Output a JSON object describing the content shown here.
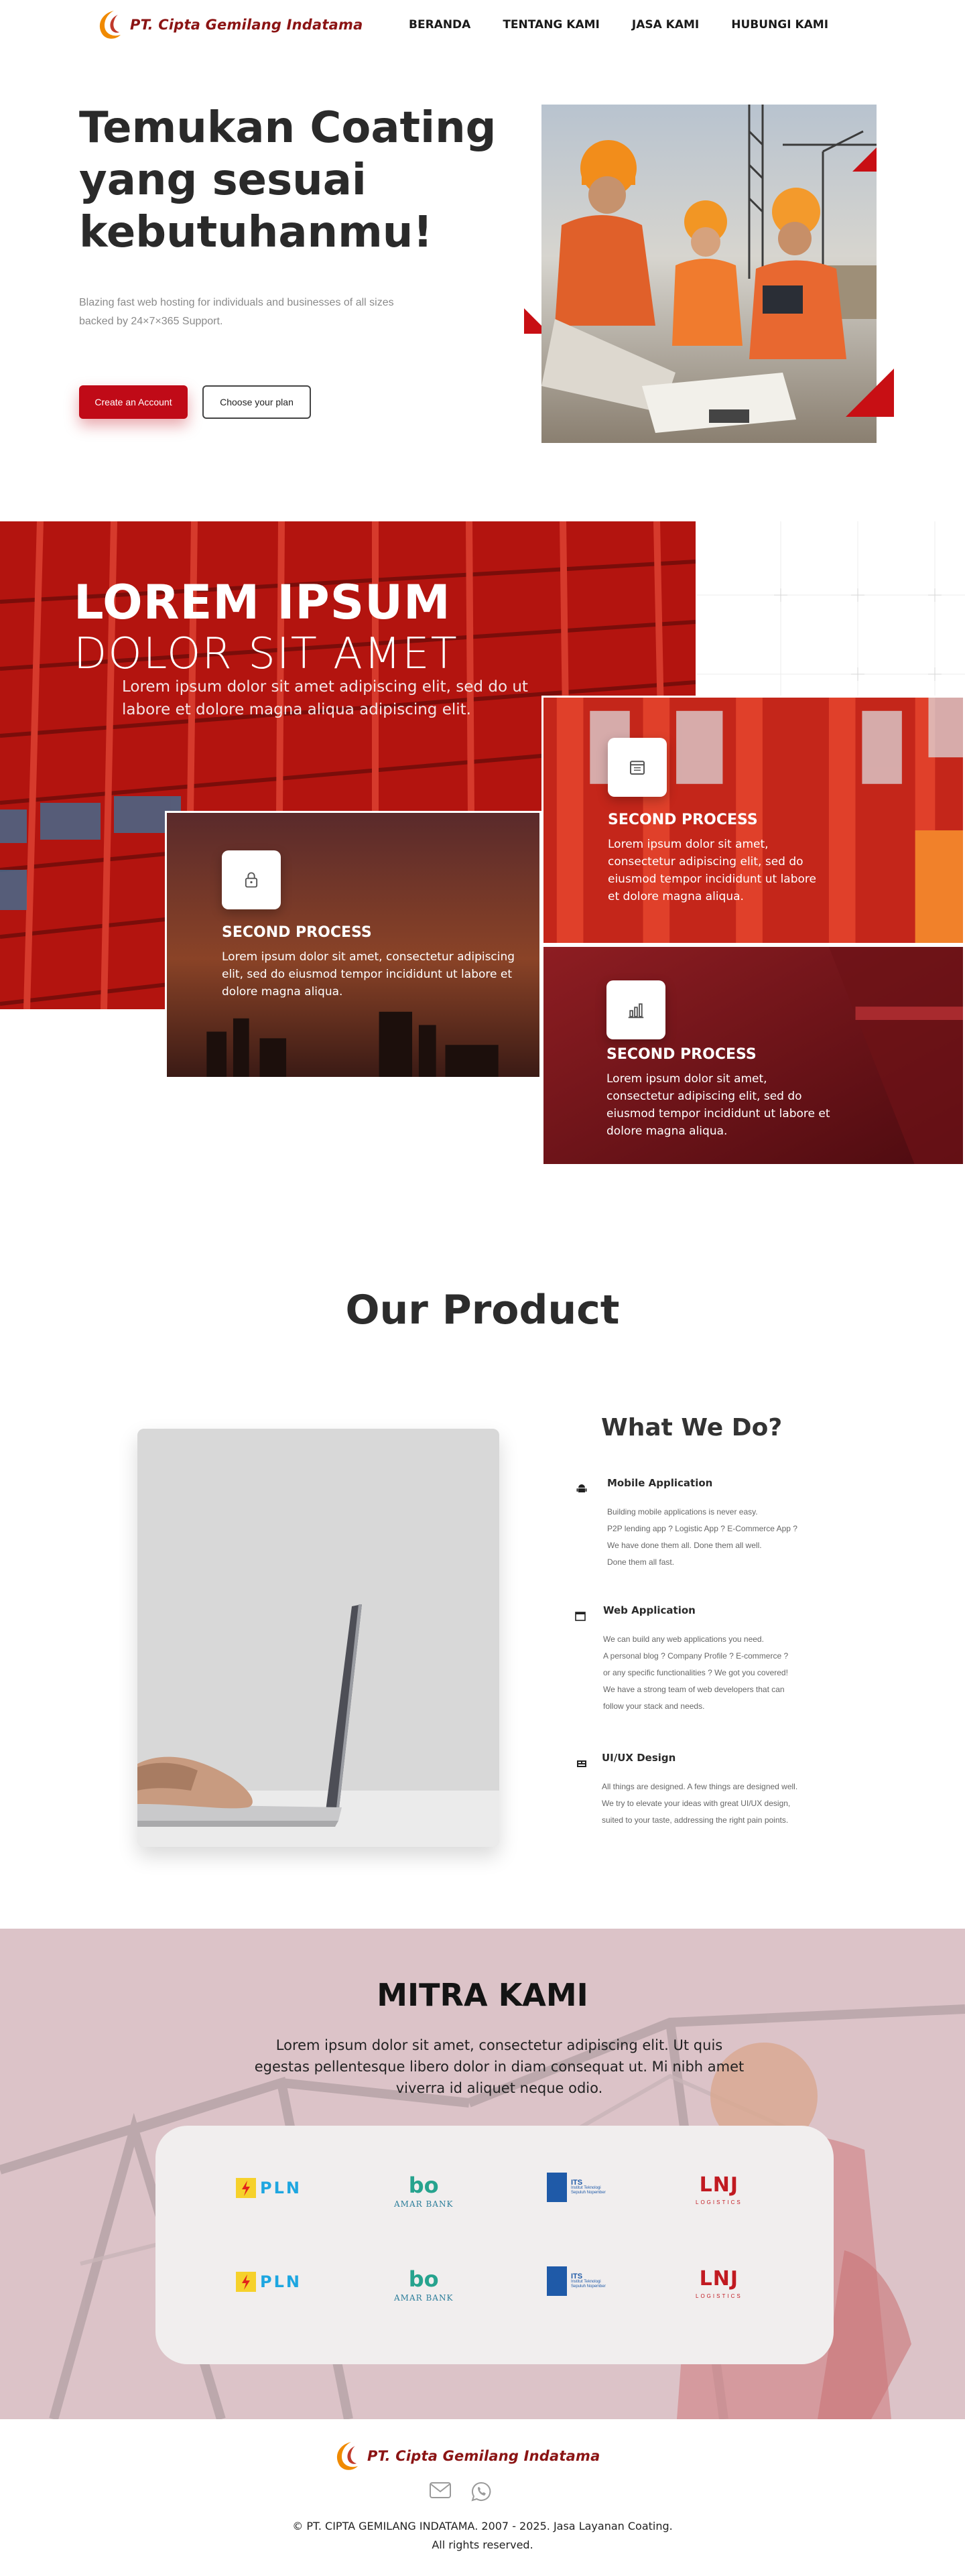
{
  "nav": {
    "logo_text": "PT. Cipta Gemilang Indatama",
    "links": [
      "BERANDA",
      "TENTANG KAMI",
      "JASA KAMI",
      "HUBUNGI KAMI"
    ]
  },
  "hero": {
    "title": "Temukan Coating yang sesuai kebutuhanmu!",
    "subtitle": "Blazing fast web hosting for individuals and businesses of all sizes backed by 24×7×365 Support.",
    "primary_button": "Create an Account",
    "secondary_button": "Choose your plan"
  },
  "intro": {
    "title": "LOREM IPSUM",
    "subtitle": "DOLOR SIT AMET",
    "paragraph": "Lorem ipsum dolor sit amet adipiscing elit, sed do ut labore et dolore magna aliqua adipiscing elit."
  },
  "process_cards": [
    {
      "icon": "lock-icon",
      "title": "SECOND PROCESS",
      "text": "Lorem ipsum dolor sit amet, consectetur adipiscing elit, sed do eiusmod tempor incididunt ut labore et dolore magna aliqua."
    },
    {
      "icon": "calendar-icon",
      "title": "SECOND PROCESS",
      "text": "Lorem ipsum dolor sit amet, consectetur adipiscing elit, sed do eiusmod tempor incididunt ut labore et dolore magna aliqua."
    },
    {
      "icon": "chart-icon",
      "title": "SECOND PROCESS",
      "text": "Lorem ipsum dolor sit amet, consectetur adipiscing elit, sed do eiusmod tempor incididunt ut labore et dolore magna aliqua."
    }
  ],
  "product": {
    "title": "Our Product",
    "what_we_do": "What We Do?",
    "features": [
      {
        "icon": "android-icon",
        "title": "Mobile Application",
        "lines": [
          "Building mobile applications is never easy.",
          "P2P lending app ? Logistic App ? E-Commerce App ?",
          "We have done them all. Done them all well.",
          "Done them all fast."
        ]
      },
      {
        "icon": "browser-icon",
        "title": "Web Application",
        "lines": [
          "We can build any web applications you need.",
          "A personal blog ? Company Profile ? E-commerce ?",
          "or any specific functionalities ? We got you covered!",
          "We have a strong team of web developers that can",
          "follow your stack and needs."
        ]
      },
      {
        "icon": "design-icon",
        "title": "UI/UX Design",
        "lines": [
          "All things are designed. A few things are designed well.",
          "We try to elevate your ideas with great UI/UX design,",
          "suited to your taste, addressing the right pain points."
        ]
      }
    ]
  },
  "mitra": {
    "title": "MITRA KAMI",
    "paragraph": "Lorem ipsum dolor sit amet, consectetur adipiscing elit. Ut quis egestas pellentesque libero dolor in diam consequat ut. Mi nibh amet viverra id aliquet neque odio.",
    "partners": [
      {
        "name": "PLN"
      },
      {
        "name": "bo",
        "tagline": "AMAR BANK"
      },
      {
        "name": "ITS",
        "tagline": "Institut Teknologi Sepuluh Nopember"
      },
      {
        "name": "LNJ",
        "tagline": "LOGISTICS"
      }
    ]
  },
  "footer": {
    "logo_text": "PT. Cipta Gemilang Indatama",
    "copyright": "© PT. CIPTA GEMILANG INDATAMA. 2007 - 2025. Jasa Layanan Coating.",
    "rights": "All rights reserved."
  },
  "colors": {
    "brand_red": "#c00a17",
    "logo_orange": "#f08a00",
    "logo_text": "#8b1414"
  }
}
